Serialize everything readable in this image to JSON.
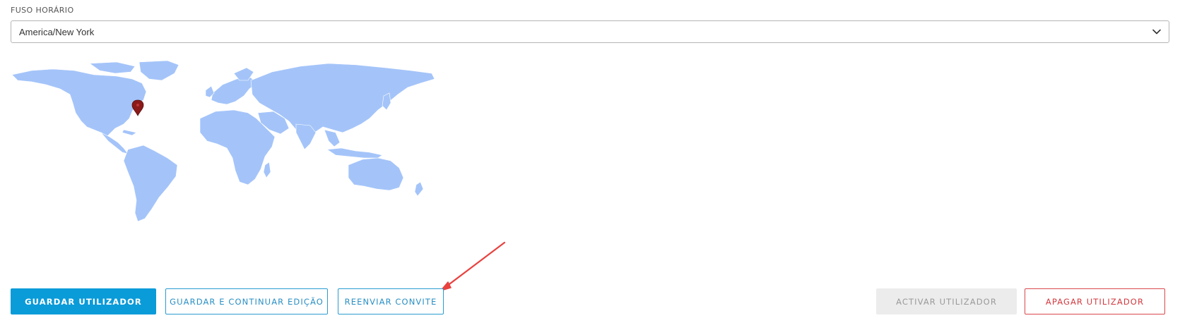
{
  "timezone": {
    "label": "FUSO HORÁRIO",
    "selected_value": "America/New York",
    "dropdown_icon": "chevron-down-icon"
  },
  "map": {
    "marker_icon": "map-pin-icon",
    "land_color": "#a4c4f9",
    "marker_color": "#8b1a1a"
  },
  "annotation": {
    "arrow_color": "#e8423f"
  },
  "actions": {
    "save_label": "GUARDAR UTILIZADOR",
    "save_continue_label": "GUARDAR E CONTINUAR EDIÇÃO",
    "resend_invite_label": "REENVIAR CONVITE",
    "activate_label": "ACTIVAR UTILIZADOR",
    "delete_label": "APAGAR UTILIZADOR"
  },
  "colors": {
    "primary": "#0a9bd9",
    "danger": "#d23a40",
    "disabled_bg": "#ececec"
  }
}
